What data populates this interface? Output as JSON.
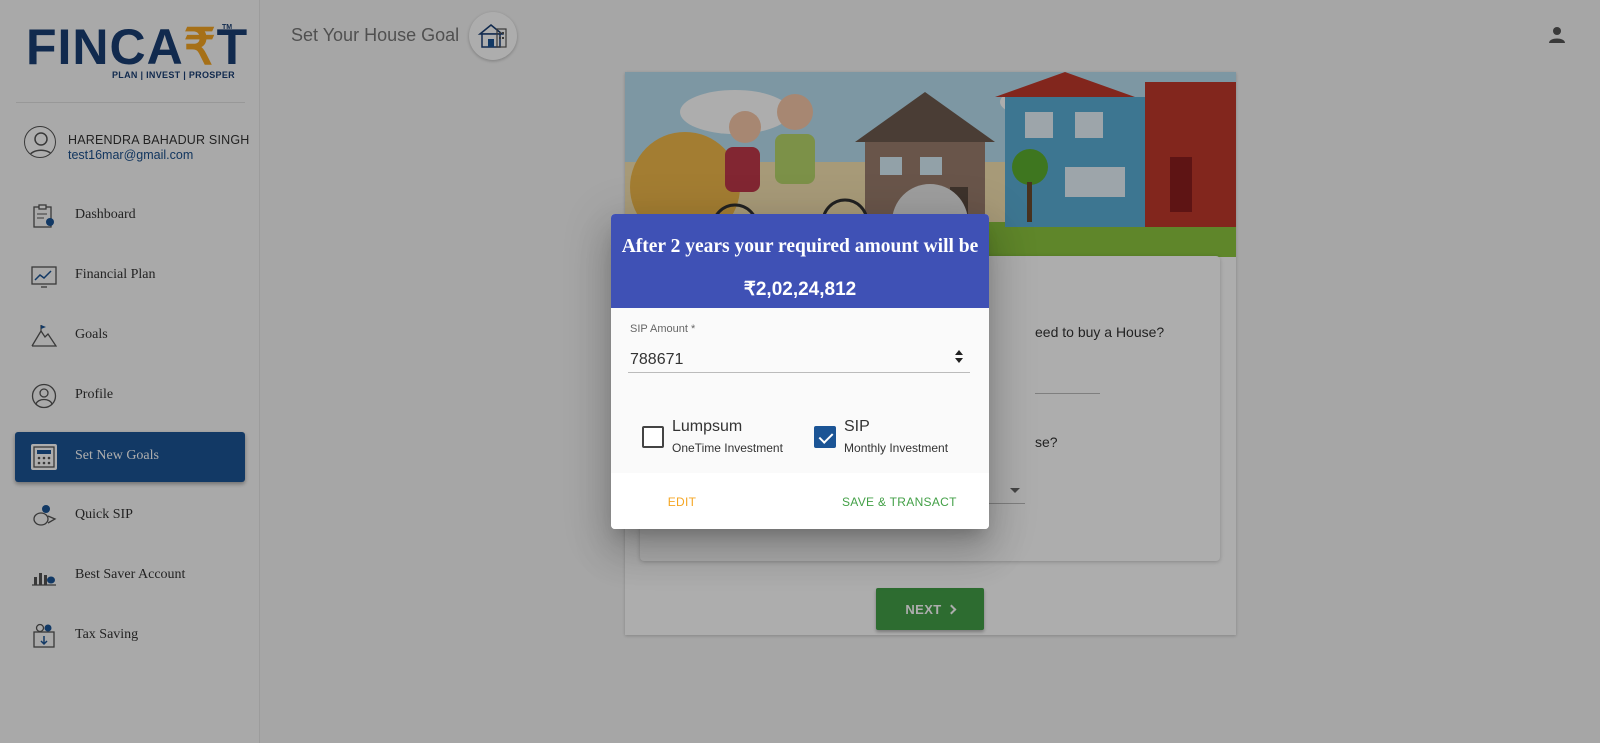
{
  "brand": {
    "name_part1": "FINCA",
    "name_rupee": "₹",
    "name_part2": "T",
    "tm": "TM",
    "tagline": "PLAN | INVEST | PROSPER"
  },
  "user": {
    "name": "HARENDRA BAHADUR SINGH",
    "email": "test16mar@gmail.com"
  },
  "sidebar": {
    "items": [
      {
        "label": "Dashboard",
        "icon": "dashboard-icon"
      },
      {
        "label": "Financial Plan",
        "icon": "chart-icon"
      },
      {
        "label": "Goals",
        "icon": "mountain-icon"
      },
      {
        "label": "Profile",
        "icon": "person-icon"
      },
      {
        "label": "Set New Goals",
        "icon": "calculator-icon",
        "active": true
      },
      {
        "label": "Quick SIP",
        "icon": "coins-icon"
      },
      {
        "label": "Best Saver Account",
        "icon": "savings-icon"
      },
      {
        "label": "Tax Saving",
        "icon": "tax-icon"
      }
    ]
  },
  "header": {
    "title": "Set Your House Goal",
    "account_icon": "account-icon"
  },
  "form": {
    "question1": "…eed to buy a House?",
    "question1_text": "eed to buy a House?",
    "question2_text": "se?",
    "next_label": "NEXT"
  },
  "dialog": {
    "title": "After 2 years your required amount will be",
    "amount": "₹2,02,24,812",
    "sip_label": "SIP Amount *",
    "sip_value": "788671",
    "options": [
      {
        "title": "Lumpsum",
        "subtitle": "OneTime Investment",
        "checked": false
      },
      {
        "title": "SIP",
        "subtitle": "Monthly Investment",
        "checked": true
      }
    ],
    "edit_label": "EDIT",
    "save_label": "SAVE & TRANSACT"
  },
  "colors": {
    "brand_blue": "#1b5495",
    "dialog_header": "#3f51b5",
    "accent_orange": "#f5a623",
    "success_green": "#43a047"
  }
}
